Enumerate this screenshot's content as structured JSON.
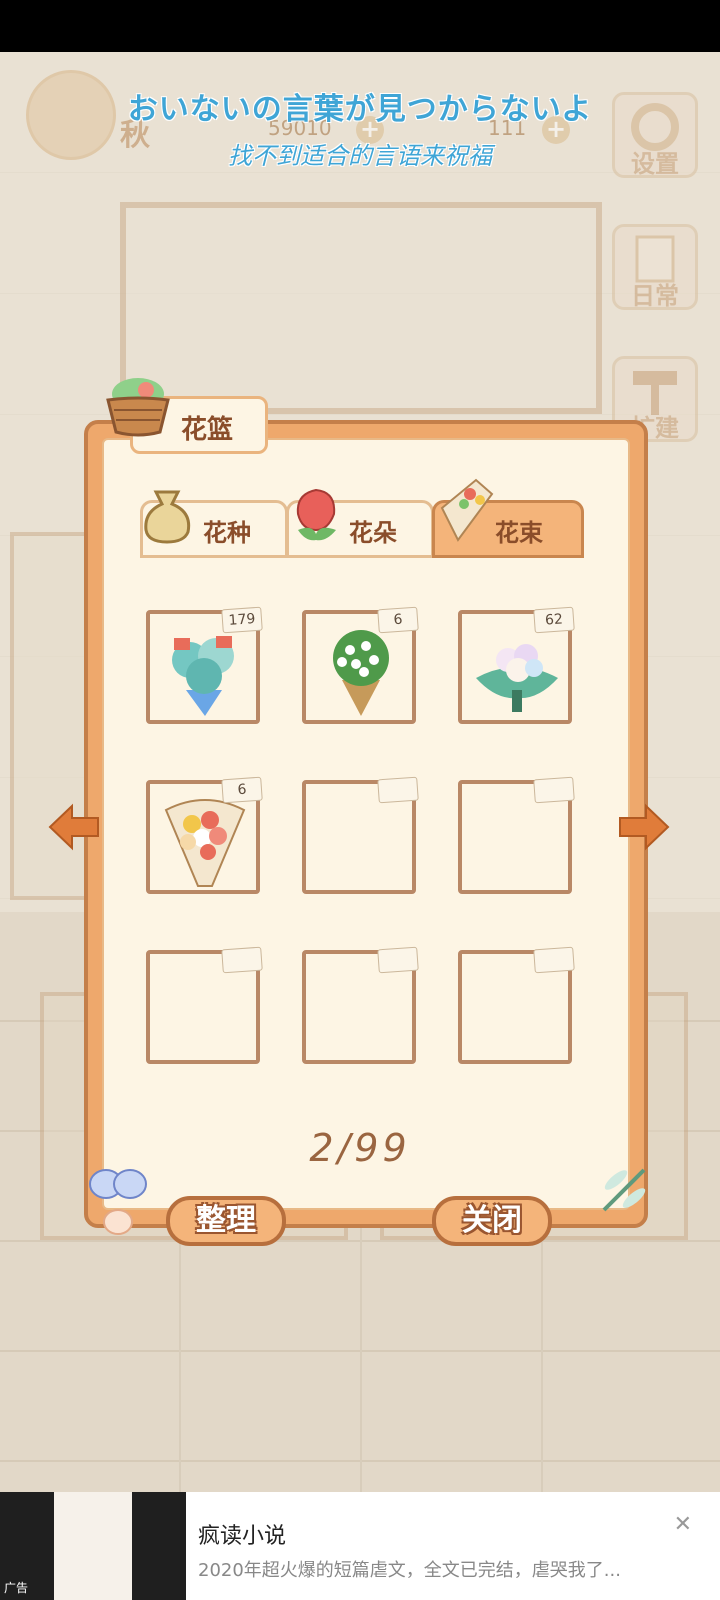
{
  "hud": {
    "name_partial": "秋",
    "coins": "59010",
    "gems": "111",
    "settings_label": "设置",
    "daily_label": "日常",
    "build_label": "扩建"
  },
  "subtitle": {
    "japanese": "おいないの言葉が見つからないよ",
    "chinese": "找不到适合的言语来祝福"
  },
  "dialog": {
    "title": "花篮",
    "tabs": [
      {
        "label": "花种",
        "active": false
      },
      {
        "label": "花朵",
        "active": false
      },
      {
        "label": "花束",
        "active": true
      }
    ],
    "slots": [
      {
        "count": "179",
        "item": "blue-bouquet"
      },
      {
        "count": "6",
        "item": "white-green-bouquet"
      },
      {
        "count": "62",
        "item": "pastel-bouquet"
      },
      {
        "count": "6",
        "item": "mixed-rose-bouquet"
      },
      {
        "count": "",
        "item": "empty"
      },
      {
        "count": "",
        "item": "empty"
      },
      {
        "count": "",
        "item": "empty"
      },
      {
        "count": "",
        "item": "empty"
      },
      {
        "count": "",
        "item": "empty"
      }
    ],
    "capacity": "2/99",
    "sort_button": "整理",
    "close_button": "关闭"
  },
  "ad": {
    "title": "疯读小说",
    "description": "2020年超火爆的短篇虐文，全文已完结，虐哭我了...",
    "tag": "广告",
    "close_symbol": "✕"
  },
  "colors": {
    "panel": "#eea86c",
    "panel_border": "#c47f4a",
    "inner": "#fdf5e4",
    "subtitle": "#3fa5d6"
  }
}
